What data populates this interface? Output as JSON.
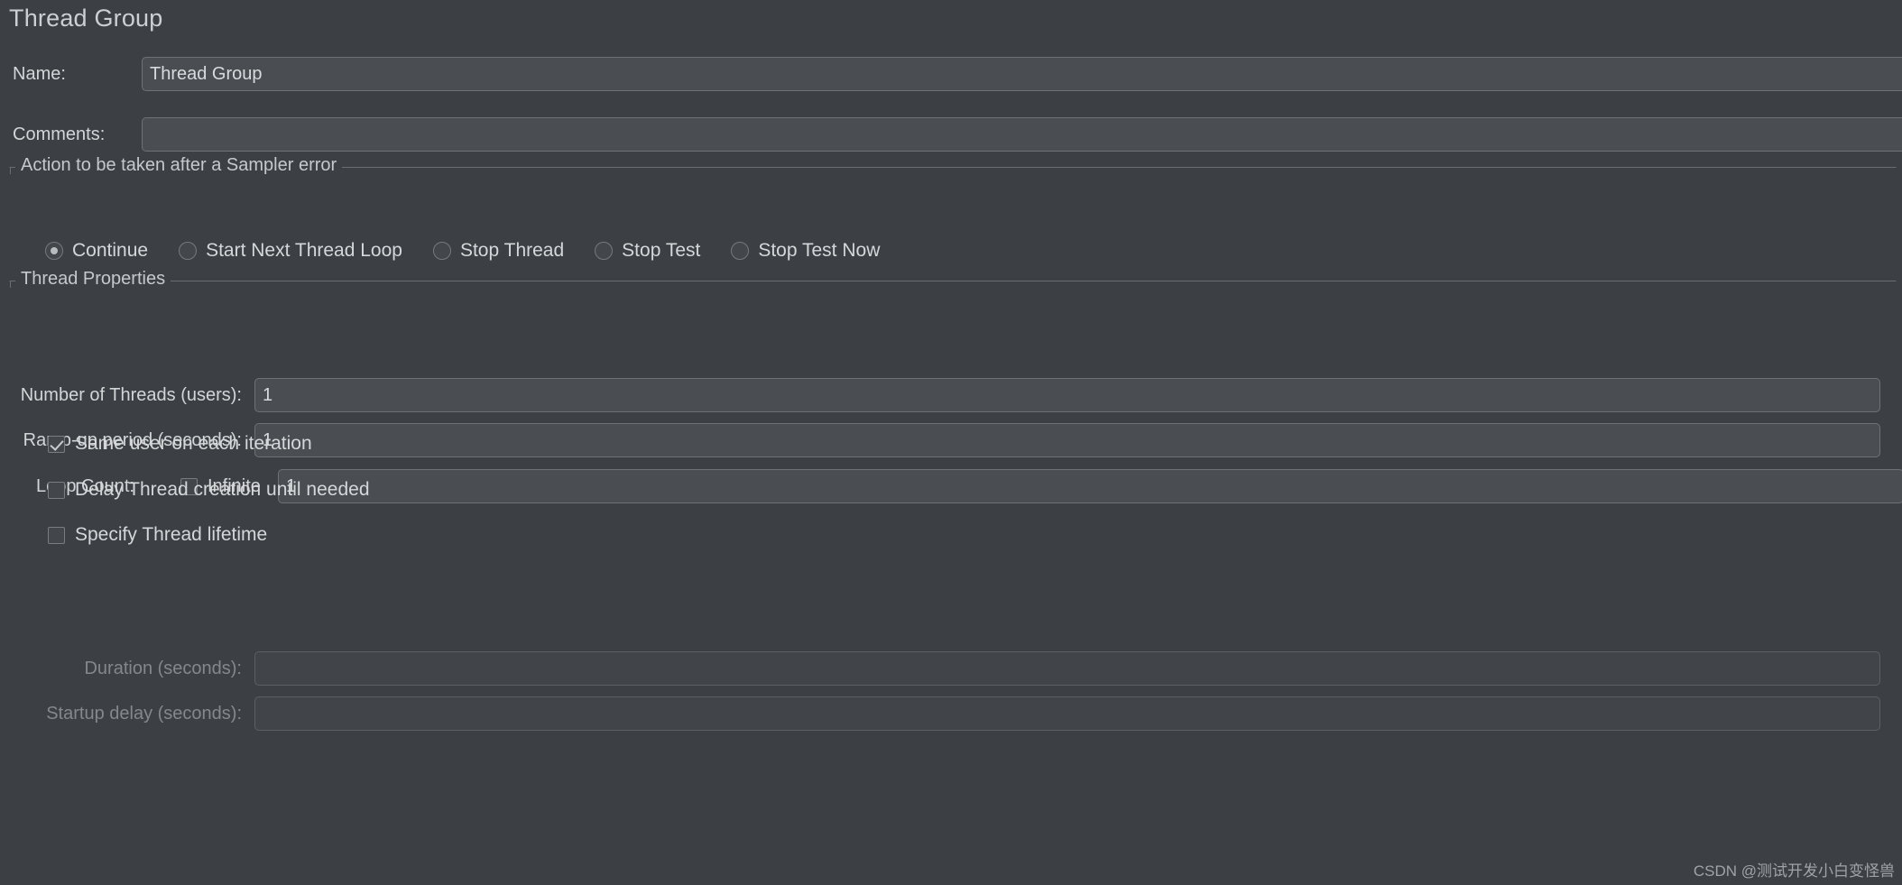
{
  "panel": {
    "title": "Thread Group"
  },
  "form": {
    "name_label": "Name:",
    "name_value": "Thread Group",
    "comments_label": "Comments:",
    "comments_value": ""
  },
  "sampler_error_group": {
    "title": "Action to be taken after a Sampler error",
    "options": [
      {
        "label": "Continue",
        "selected": true
      },
      {
        "label": "Start Next Thread Loop",
        "selected": false
      },
      {
        "label": "Stop Thread",
        "selected": false
      },
      {
        "label": "Stop Test",
        "selected": false
      },
      {
        "label": "Stop Test Now",
        "selected": false
      }
    ]
  },
  "thread_properties": {
    "title": "Thread Properties",
    "number_of_threads_label": "Number of Threads (users):",
    "number_of_threads_value": "1",
    "ramp_up_label": "Ramp-up period (seconds):",
    "ramp_up_value": "1",
    "loop_count_label": "Loop Count:",
    "loop_infinite_label": "Infinite",
    "loop_infinite_checked": false,
    "loop_count_value": "1",
    "same_user_label": "Same user on each iteration",
    "same_user_checked": true,
    "delay_thread_label": "Delay Thread creation until needed",
    "delay_thread_checked": false,
    "specify_lifetime_label": "Specify Thread lifetime",
    "specify_lifetime_checked": false,
    "duration_label": "Duration (seconds):",
    "duration_value": "",
    "startup_delay_label": "Startup delay (seconds):",
    "startup_delay_value": ""
  },
  "watermark": {
    "text": "CSDN @测试开发小白变怪兽"
  },
  "colors": {
    "background": "#3c4044",
    "field_background": "#4a4e52",
    "field_border": "#6e7276",
    "text": "#d3d5d7",
    "disabled_text": "#84888c",
    "group_border": "#6a6e72"
  }
}
